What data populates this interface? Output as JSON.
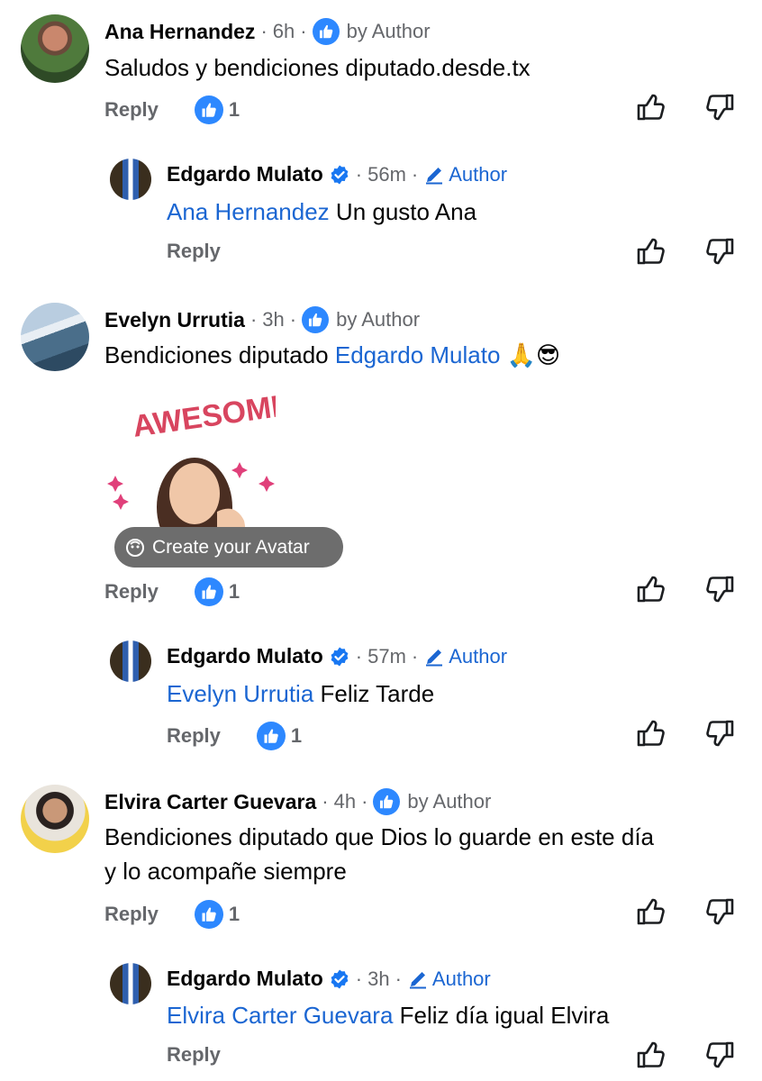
{
  "comments": [
    {
      "name": "Ana Hernandez",
      "time": "6h",
      "badge": "by Author",
      "text": "Saludos y bendiciones diputado.desde.tx",
      "reply": "Reply",
      "likes": "1",
      "reply_item": {
        "name": "Edgardo Mulato",
        "time": "56m",
        "author": "Author",
        "mention": "Ana Hernandez",
        "text": " Un gusto Ana",
        "reply": "Reply"
      }
    },
    {
      "name": "Evelyn Urrutia",
      "time": "3h",
      "badge": "by Author",
      "text_before": "Bendiciones diputado ",
      "mention": "Edgardo Mulato",
      "emoji": " 🙏😎",
      "sticker_text": "AWESOME!",
      "sticker_button": "Create your Avatar",
      "reply": "Reply",
      "likes": "1",
      "reply_item": {
        "name": "Edgardo Mulato",
        "time": "57m",
        "author": "Author",
        "mention": "Evelyn Urrutia",
        "text": " Feliz Tarde",
        "reply": "Reply",
        "likes": "1"
      }
    },
    {
      "name": "Elvira Carter Guevara",
      "time": "4h",
      "badge": "by Author",
      "text_line1": "Bendiciones diputado que Dios lo guarde en este día",
      "text_line2": "y lo acompañe siempre",
      "reply": "Reply",
      "likes": "1",
      "reply_item": {
        "name": "Edgardo Mulato",
        "time": "3h",
        "author": "Author",
        "mention": "Elvira Carter Guevara",
        "text": " Feliz día igual Elvira",
        "reply": "Reply"
      }
    }
  ],
  "dot": "·",
  "colors": {
    "link": "#1b66d2",
    "like_blue": "#2d88ff",
    "meta": "#65676b",
    "verified": "#1877f2"
  },
  "icons": [
    "like-badge-icon",
    "verified-icon",
    "pencil-icon",
    "thumbs-up-icon",
    "thumbs-down-icon",
    "avatar-face-icon"
  ]
}
